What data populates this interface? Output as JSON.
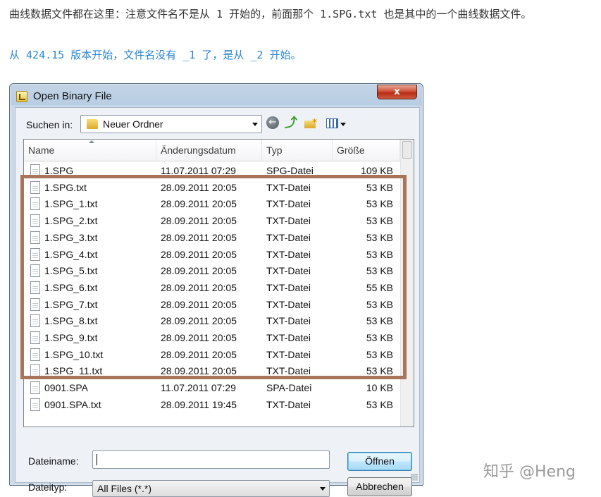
{
  "article": {
    "line1": "曲线数据文件都在这里：注意文件名不是从 1 开始的，前面那个 1.SPG.txt 也是其中的一个曲线数据文件。",
    "line2": "从  424.15 版本开始，文件名没有 _1 了，是从 _2 开始。"
  },
  "dialog": {
    "title": "Open Binary File",
    "close_label": "x",
    "look_in_label": "Suchen in:",
    "look_in_value": "Neuer Ordner",
    "columns": [
      "Name",
      "Änderungsdatum",
      "Typ",
      "Größe"
    ],
    "files": [
      {
        "name": "1.SPG",
        "date": "11.07.2011 07:29",
        "type": "SPG-Datei",
        "size": "109 KB"
      },
      {
        "name": "1.SPG.txt",
        "date": "28.09.2011 20:05",
        "type": "TXT-Datei",
        "size": "53 KB"
      },
      {
        "name": "1.SPG_1.txt",
        "date": "28.09.2011 20:05",
        "type": "TXT-Datei",
        "size": "53 KB"
      },
      {
        "name": "1.SPG_2.txt",
        "date": "28.09.2011 20:05",
        "type": "TXT-Datei",
        "size": "53 KB"
      },
      {
        "name": "1.SPG_3.txt",
        "date": "28.09.2011 20:05",
        "type": "TXT-Datei",
        "size": "53 KB"
      },
      {
        "name": "1.SPG_4.txt",
        "date": "28.09.2011 20:05",
        "type": "TXT-Datei",
        "size": "53 KB"
      },
      {
        "name": "1.SPG_5.txt",
        "date": "28.09.2011 20:05",
        "type": "TXT-Datei",
        "size": "53 KB"
      },
      {
        "name": "1.SPG_6.txt",
        "date": "28.09.2011 20:05",
        "type": "TXT-Datei",
        "size": "55 KB"
      },
      {
        "name": "1.SPG_7.txt",
        "date": "28.09.2011 20:05",
        "type": "TXT-Datei",
        "size": "53 KB"
      },
      {
        "name": "1.SPG_8.txt",
        "date": "28.09.2011 20:05",
        "type": "TXT-Datei",
        "size": "53 KB"
      },
      {
        "name": "1.SPG_9.txt",
        "date": "28.09.2011 20:05",
        "type": "TXT-Datei",
        "size": "53 KB"
      },
      {
        "name": "1.SPG_10.txt",
        "date": "28.09.2011 20:05",
        "type": "TXT-Datei",
        "size": "53 KB"
      },
      {
        "name": "1.SPG_11.txt",
        "date": "28.09.2011 20:05",
        "type": "TXT-Datei",
        "size": "53 KB"
      },
      {
        "name": "0901.SPA",
        "date": "11.07.2011 07:29",
        "type": "SPA-Datei",
        "size": "10 KB"
      },
      {
        "name": "0901.SPA.txt",
        "date": "28.09.2011 19:45",
        "type": "TXT-Datei",
        "size": "53 KB"
      }
    ],
    "filename_label": "Dateiname:",
    "filename_value": "",
    "filetype_label": "Dateityp:",
    "filetype_value": "All Files (*.*)",
    "open_label": "Öffnen",
    "cancel_label": "Abbrechen"
  },
  "watermark": "知乎 @Heng",
  "colors": {
    "highlight_border": "#a8745a",
    "link_blue": "#2a86d1"
  }
}
